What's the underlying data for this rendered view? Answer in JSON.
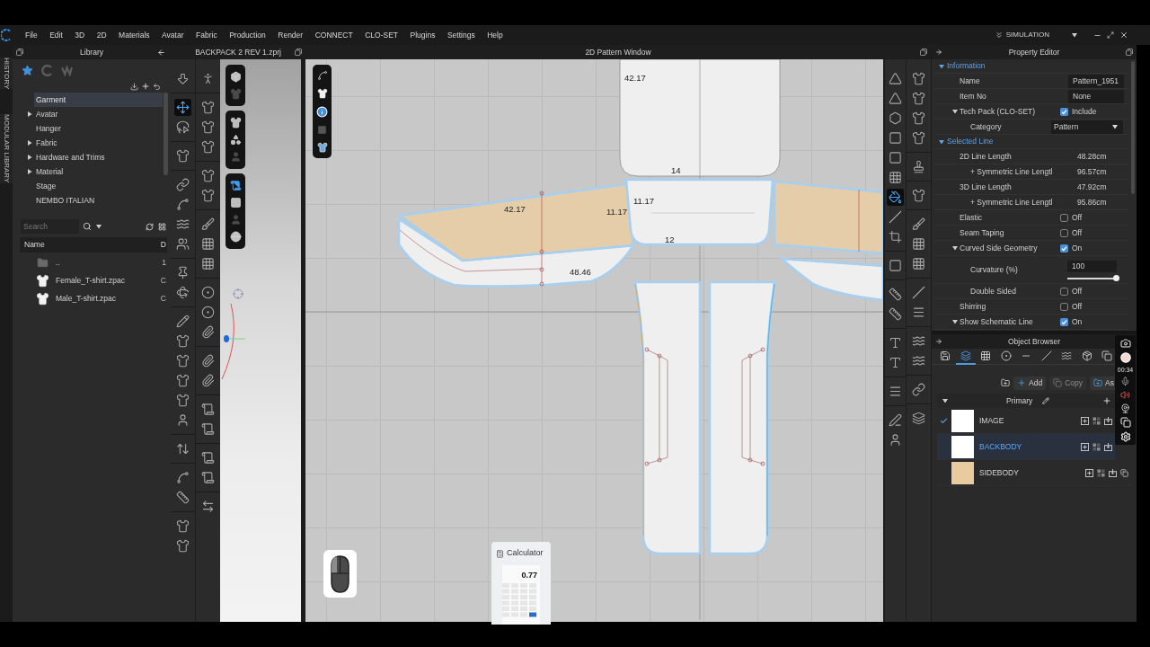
{
  "menu_bar": {
    "items": [
      "File",
      "Edit",
      "3D",
      "2D",
      "Materials",
      "Avatar",
      "Fabric",
      "Production",
      "Render",
      "CONNECT",
      "CLO-SET",
      "Plugins",
      "Settings",
      "Help"
    ],
    "mode": "SIMULATION"
  },
  "side_tabs": [
    "HISTORY",
    "MODULAR LIBRARY"
  ],
  "library": {
    "title": "Library",
    "tabs": [
      {
        "selected": true
      },
      {
        "selected": false
      },
      {
        "selected": false
      }
    ],
    "tree": [
      {
        "label": "Garment",
        "selected": true
      },
      {
        "label": "Avatar",
        "expanded": false,
        "selected": false
      },
      {
        "label": "Hanger",
        "selected": false
      },
      {
        "label": "Fabric",
        "expanded": false,
        "selected": false
      },
      {
        "label": "Hardware and Trims",
        "expanded": false,
        "selected": false
      },
      {
        "label": "Material",
        "expanded": false,
        "selected": false
      },
      {
        "label": "Stage",
        "selected": false
      },
      {
        "label": "NEMBO ITALIAN",
        "selected": false
      }
    ],
    "search": {
      "placeholder": "Search"
    },
    "file_list": {
      "columns": [
        "Name",
        "D"
      ],
      "rows": [
        {
          "kind": "folder",
          "name": "..",
          "column_2": "1"
        },
        {
          "kind": "file",
          "name": "Female_T-shirt.zpac",
          "column_2": "C"
        },
        {
          "kind": "file",
          "name": "Male_T-shirt.zpac",
          "column_2": "C"
        }
      ]
    }
  },
  "viewport_3d": {
    "title": "BACKPACK 2 REV 1.zprj",
    "toolbar": {
      "column_1": [
        {
          "selected": false
        },
        {
          "selected": true
        },
        {
          "selected": false
        },
        {
          "selected": false
        },
        {
          "selected": false
        },
        {
          "selected": false
        },
        {
          "selected": false
        },
        {
          "selected": false
        },
        {
          "selected": false
        },
        {
          "selected": false
        },
        {
          "selected": false
        },
        {
          "selected": false
        },
        {
          "selected": false
        },
        {
          "selected": false
        },
        {
          "selected": false
        },
        {
          "selected": false
        },
        {
          "selected": false
        },
        {
          "selected": false
        },
        {
          "selected": false
        },
        {
          "selected": false
        },
        {
          "selected": false
        }
      ],
      "column_2": [
        {
          "selected": false
        },
        {
          "selected": false
        },
        {
          "selected": false
        },
        {
          "selected": false
        },
        {
          "selected": false
        },
        {
          "selected": false
        },
        {
          "selected": false
        },
        {
          "selected": false
        },
        {
          "selected": false
        },
        {
          "selected": false
        },
        {
          "selected": false
        },
        {
          "selected": false
        },
        {
          "selected": false
        },
        {
          "selected": false
        },
        {
          "selected": false
        },
        {
          "selected": false
        },
        {
          "selected": false
        },
        {
          "selected": false
        },
        {
          "selected": false
        }
      ]
    },
    "view_tools": [
      {
        "selected": false
      },
      {
        "selected": false
      },
      {
        "selected": false
      },
      {
        "selected": false
      },
      {
        "selected": false
      },
      {
        "selected": true
      },
      {
        "selected": false
      },
      {
        "selected": false
      },
      {
        "selected": false
      }
    ]
  },
  "pattern_window": {
    "title": "2D Pattern Window",
    "measurements": [
      "42.17",
      "14",
      "42.17",
      "11.17",
      "11.17",
      "12",
      "48.46"
    ],
    "toolbar": {
      "column_1": [
        {
          "selected": false
        },
        {
          "selected": false
        },
        {
          "selected": false
        },
        {
          "selected": false
        },
        {
          "selected": false
        },
        {
          "selected": false
        },
        {
          "selected": true
        },
        {
          "selected": false
        },
        {
          "selected": false
        },
        {
          "selected": false
        },
        {
          "selected": false
        },
        {
          "selected": false
        },
        {
          "selected": false
        },
        {
          "selected": false
        },
        {
          "selected": false
        },
        {
          "selected": false
        },
        {
          "selected": false
        }
      ],
      "column_2": [
        {
          "selected": false
        },
        {
          "selected": false
        },
        {
          "selected": false
        },
        {
          "selected": false
        },
        {
          "selected": false
        },
        {
          "selected": false
        },
        {
          "selected": false
        },
        {
          "selected": false
        },
        {
          "selected": false
        },
        {
          "selected": false
        },
        {
          "selected": false
        },
        {
          "selected": false
        },
        {
          "selected": false
        },
        {
          "selected": false
        },
        {
          "selected": false
        }
      ]
    }
  },
  "property_editor": {
    "title": "Property Editor",
    "sections": [
      {
        "label": "Information",
        "expanded": true,
        "rows": [
          {
            "kind": "field",
            "label": "Name",
            "value": "Pattern_1951"
          },
          {
            "kind": "field",
            "label": "Item No",
            "value": "None"
          },
          {
            "kind": "check",
            "label": "Tech Pack (CLO-SET)",
            "expanded": true,
            "checked": true,
            "value": "Include",
            "children": [
              {
                "kind": "select",
                "label": "Category",
                "value": "Pattern"
              }
            ]
          }
        ]
      },
      {
        "label": "Selected Line",
        "expanded": true,
        "rows": [
          {
            "kind": "text",
            "label": "2D Line Length",
            "value": "48.28cm",
            "children": [
              {
                "kind": "text",
                "label": "+ Symmetric Line Lengtl",
                "value": "96.57cm"
              }
            ]
          },
          {
            "kind": "text",
            "label": "3D Line Length",
            "value": "47.92cm",
            "children": [
              {
                "kind": "text",
                "label": "+ Symmetric Line Lengtl",
                "value": "95.86cm"
              }
            ]
          },
          {
            "kind": "check",
            "label": "Elastic",
            "checked": false,
            "value": "Off"
          },
          {
            "kind": "check",
            "label": "Seam Taping",
            "checked": false,
            "value": "Off"
          },
          {
            "kind": "check",
            "label": "Curved Side Geometry",
            "expanded": true,
            "checked": true,
            "value": "On",
            "children": [
              {
                "kind": "slider",
                "label": "Curvature (%)",
                "value": "100",
                "level": 1
              },
              {
                "kind": "check",
                "label": "Double Sided",
                "checked": false,
                "value": "Off"
              }
            ]
          },
          {
            "kind": "check",
            "label": "Shirring",
            "checked": false,
            "value": "Off"
          },
          {
            "kind": "check",
            "label": "Show Schematic Line",
            "expanded": true,
            "checked": true,
            "value": "On"
          }
        ]
      }
    ]
  },
  "object_browser": {
    "title": "Object Browser",
    "tabs": [
      {
        "selected": false
      },
      {
        "selected": true
      },
      {
        "selected": false
      },
      {
        "selected": false
      },
      {
        "selected": false
      },
      {
        "selected": false
      },
      {
        "selected": false
      },
      {
        "selected": false
      },
      {
        "selected": false
      }
    ],
    "actions": [
      {
        "label": "Add",
        "disabled": false
      },
      {
        "label": "Copy",
        "disabled": true
      },
      {
        "label": "As",
        "disabled": false
      }
    ],
    "group": {
      "label": "Primary",
      "expanded": true
    },
    "items": [
      {
        "label": "IMAGE",
        "checked": true,
        "selected": false,
        "color": "#ffffff"
      },
      {
        "label": "BACKBODY",
        "checked": false,
        "selected": true,
        "color": "#ffffff"
      },
      {
        "label": "SIDEBODY",
        "checked": false,
        "selected": false,
        "color": "#e8cb9e"
      }
    ]
  },
  "recorder": {
    "time": "00:34"
  },
  "taskbar_preview": {
    "title": "Calculator",
    "display": "0.77"
  }
}
